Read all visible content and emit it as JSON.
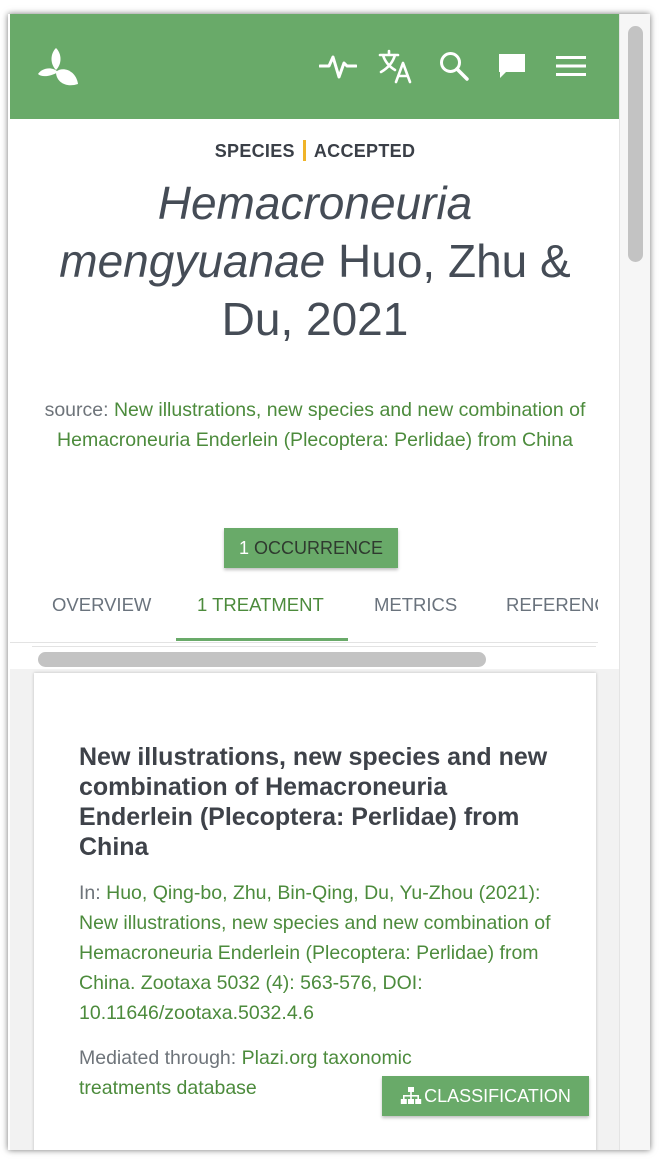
{
  "header": {
    "logo_icon": "gbif-leaf-icon",
    "icons": [
      "activity-icon",
      "translate-icon",
      "search-icon",
      "feedback-icon",
      "menu-icon"
    ],
    "background_color": "#69aa69"
  },
  "status": {
    "rank": "SPECIES",
    "taxonomic_status": "ACCEPTED",
    "separator_color": "#f0b429"
  },
  "title": {
    "scientific_name_italic": "Hemacroneuria mengyuanae",
    "authorship": " Huo, Zhu & Du, 2021"
  },
  "source": {
    "label": "source: ",
    "link_text": "New illustrations, new species and new combination of Hemacroneuria Enderlein (Plecoptera: Perlidae) from China"
  },
  "occurrence_button": {
    "count": "1",
    "label": " OCCURRENCE"
  },
  "tabs": [
    {
      "label": "OVERVIEW",
      "active": false
    },
    {
      "label": "1 TREATMENT",
      "active": true
    },
    {
      "label": "METRICS",
      "active": false
    },
    {
      "label": "REFERENCES",
      "active": false
    }
  ],
  "treatment": {
    "title": "New illustrations, new species and new combination of Hemacroneuria Enderlein (Plecoptera: Perlidae) from China",
    "in_label": "In: ",
    "citation": "Huo, Qing-bo, Zhu, Bin-Qing, Du, Yu-Zhou (2021): New illustrations, new species and new combination of Hemacroneuria Enderlein (Plecoptera: Perlidae) from China. Zootaxa 5032 (4): 563-576, DOI: 10.11646/zootaxa.5032.4.6",
    "mediated_label": "Mediated through: ",
    "mediated_link": "Plazi.org taxonomic treatments database",
    "classification_button": "CLASSIFICATION",
    "classification_icon": "sitemap-icon"
  },
  "colors": {
    "accent_green": "#69aa69",
    "link_green": "#4c8b3c",
    "text_dark": "#454c56",
    "text_muted": "#6e747a"
  }
}
